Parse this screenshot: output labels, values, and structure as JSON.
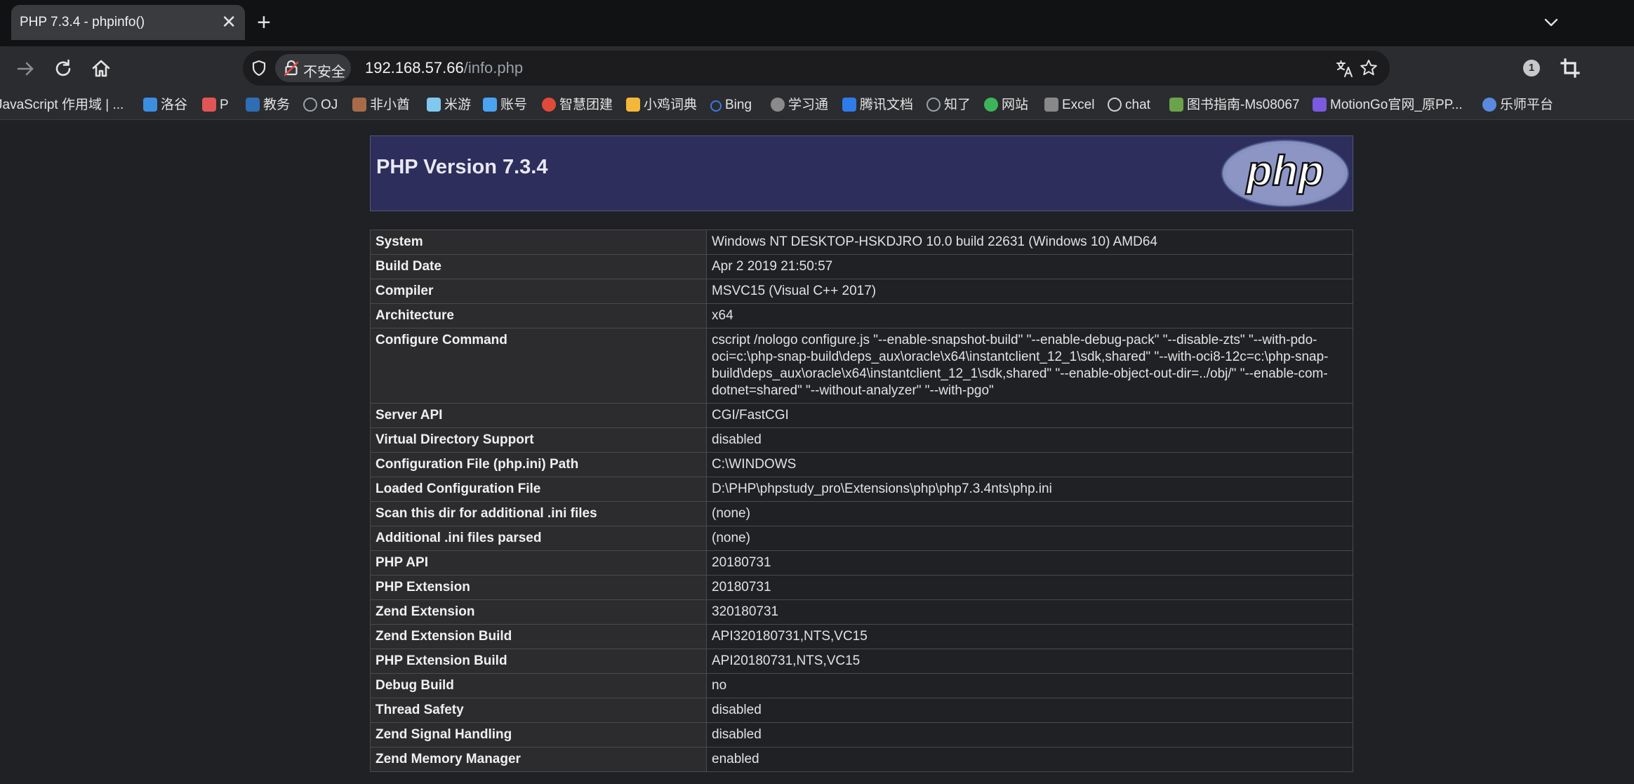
{
  "tab": {
    "title": "PHP 7.3.4 - phpinfo()",
    "close_glyph": "✕",
    "new_tab_glyph": "+"
  },
  "address_bar": {
    "security_label": "不安全",
    "url_host": "192.168.57.66",
    "url_path": "/info.php"
  },
  "extensions": {
    "badge_count": "1"
  },
  "bookmarks": [
    {
      "label": "JavaScript 作用域 | ...",
      "color": "#f0db4f"
    },
    {
      "label": "洛谷",
      "color": "#3b8ee0"
    },
    {
      "label": "P",
      "color": "#e05555"
    },
    {
      "label": "教务",
      "color": "#2f6db5"
    },
    {
      "label": "OJ",
      "color": "#9aa0a6"
    },
    {
      "label": "非小酋",
      "color": "#a86b4a"
    },
    {
      "label": "米游",
      "color": "#7fc8f0"
    },
    {
      "label": "账号",
      "color": "#4aa3f0"
    },
    {
      "label": "智慧团建",
      "color": "#e04a3a"
    },
    {
      "label": "小鸡词典",
      "color": "#f3b73a"
    },
    {
      "label": "Bing",
      "color": "#3a7be0"
    },
    {
      "label": "学习通",
      "color": "#8a8a8a"
    },
    {
      "label": "腾讯文档",
      "color": "#2f7be8"
    },
    {
      "label": "知了",
      "color": "#9aa0a6"
    },
    {
      "label": "网站",
      "color": "#3cb55a"
    },
    {
      "label": "Excel",
      "color": "#888888"
    },
    {
      "label": "chat",
      "color": "#cfcfcf"
    },
    {
      "label": "图书指南-Ms08067",
      "color": "#6ba34a"
    },
    {
      "label": "MotionGo官网_原PP...",
      "color": "#7a5ae0"
    },
    {
      "label": "乐师平台",
      "color": "#5a8ae0"
    }
  ],
  "php": {
    "version_title": "PHP Version 7.3.4",
    "logo_text": "php"
  },
  "info_rows": [
    {
      "key": "System",
      "value": "Windows NT DESKTOP-HSKDJRO 10.0 build 22631 (Windows 10) AMD64"
    },
    {
      "key": "Build Date",
      "value": "Apr 2 2019 21:50:57"
    },
    {
      "key": "Compiler",
      "value": "MSVC15 (Visual C++ 2017)"
    },
    {
      "key": "Architecture",
      "value": "x64"
    },
    {
      "key": "Configure Command",
      "value": "cscript /nologo configure.js \"--enable-snapshot-build\" \"--enable-debug-pack\" \"--disable-zts\" \"--with-pdo-oci=c:\\php-snap-build\\deps_aux\\oracle\\x64\\instantclient_12_1\\sdk,shared\" \"--with-oci8-12c=c:\\php-snap-build\\deps_aux\\oracle\\x64\\instantclient_12_1\\sdk,shared\" \"--enable-object-out-dir=../obj/\" \"--enable-com-dotnet=shared\" \"--without-analyzer\" \"--with-pgo\""
    },
    {
      "key": "Server API",
      "value": "CGI/FastCGI"
    },
    {
      "key": "Virtual Directory Support",
      "value": "disabled"
    },
    {
      "key": "Configuration File (php.ini) Path",
      "value": "C:\\WINDOWS"
    },
    {
      "key": "Loaded Configuration File",
      "value": "D:\\PHP\\phpstudy_pro\\Extensions\\php\\php7.3.4nts\\php.ini"
    },
    {
      "key": "Scan this dir for additional .ini files",
      "value": "(none)"
    },
    {
      "key": "Additional .ini files parsed",
      "value": "(none)"
    },
    {
      "key": "PHP API",
      "value": "20180731"
    },
    {
      "key": "PHP Extension",
      "value": "20180731"
    },
    {
      "key": "Zend Extension",
      "value": "320180731"
    },
    {
      "key": "Zend Extension Build",
      "value": "API320180731,NTS,VC15"
    },
    {
      "key": "PHP Extension Build",
      "value": "API20180731,NTS,VC15"
    },
    {
      "key": "Debug Build",
      "value": "no"
    },
    {
      "key": "Thread Safety",
      "value": "disabled"
    },
    {
      "key": "Zend Signal Handling",
      "value": "disabled"
    },
    {
      "key": "Zend Memory Manager",
      "value": "enabled"
    }
  ]
}
